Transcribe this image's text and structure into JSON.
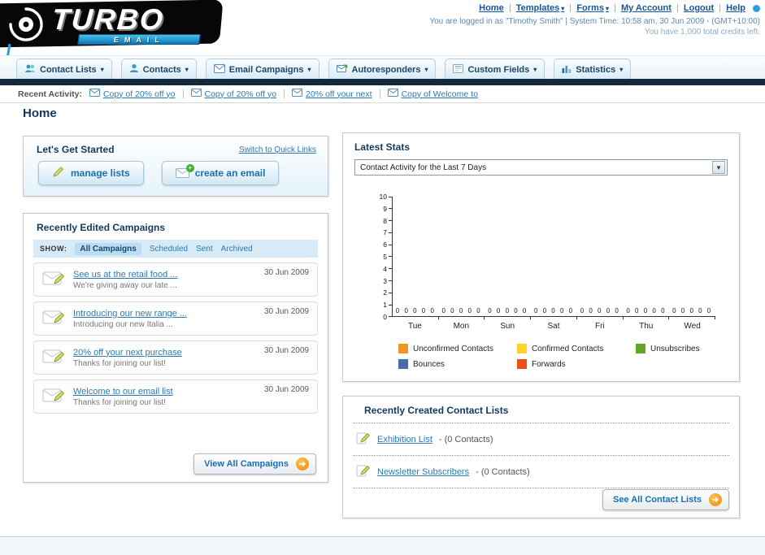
{
  "icons": {
    "caret_down": "▾",
    "select_arrow": "▼",
    "arrow_right": "➔"
  },
  "logo": {
    "title": "TURBO",
    "subtitle": "EMAIL"
  },
  "header": {
    "links": [
      {
        "label": "Home"
      },
      {
        "label": "Templates"
      },
      {
        "label": "Forms"
      },
      {
        "label": "My Account"
      },
      {
        "label": "Logout"
      },
      {
        "label": "Help"
      }
    ],
    "login_info": "You are logged in as \"Timothy Smith\" | System Time: 10:58 am, 30 Jun 2009 - (GMT+10:00)",
    "credits_info": "You have 1,000 total credits left."
  },
  "nav": {
    "tabs": [
      {
        "label": "Contact Lists"
      },
      {
        "label": "Contacts"
      },
      {
        "label": "Email Campaigns"
      },
      {
        "label": "Autoresponders"
      },
      {
        "label": "Custom Fields"
      },
      {
        "label": "Statistics"
      }
    ]
  },
  "activity": {
    "label": "Recent Activity:",
    "items": [
      {
        "label": "Copy of 20% off yo"
      },
      {
        "label": "Copy of 20% off yo"
      },
      {
        "label": "20% off your next"
      },
      {
        "label": "Copy of Welcome to"
      }
    ]
  },
  "page": {
    "title": "Home"
  },
  "get_started": {
    "title": "Let's Get Started",
    "switch_link": "Switch to Quick Links",
    "manage_lists_button": "manage lists",
    "create_email_button": "create an email"
  },
  "campaigns": {
    "title": "Recently Edited Campaigns",
    "show_label": "SHOW:",
    "filters": [
      {
        "label": "All Campaigns",
        "selected": true
      },
      {
        "label": "Scheduled",
        "selected": false
      },
      {
        "label": "Sent",
        "selected": false
      },
      {
        "label": "Archived",
        "selected": false
      }
    ],
    "items": [
      {
        "title": "See us at the retail food ...",
        "subtitle": "We're giving away our late ...",
        "date": "30 Jun 2009"
      },
      {
        "title": "Introducing our new range ...",
        "subtitle": "Introducing our new Italia ...",
        "date": "30 Jun 2009"
      },
      {
        "title": "20% off your next purchase",
        "subtitle": "Thanks for joining our list!",
        "date": "30 Jun 2009"
      },
      {
        "title": "Welcome to our email list",
        "subtitle": "Thanks for joining our list!",
        "date": "30 Jun 2009"
      }
    ],
    "view_all_button": "View All Campaigns"
  },
  "stats": {
    "title": "Latest Stats",
    "dropdown_value": "Contact Activity for the Last 7 Days"
  },
  "chart_data": {
    "type": "bar",
    "title": "Contact Activity for the Last 7 Days",
    "categories": [
      "Tue",
      "Mon",
      "Sun",
      "Sat",
      "Fri",
      "Thu",
      "Wed"
    ],
    "series": [
      {
        "name": "Unconfirmed Contacts",
        "color": "#f7941d",
        "values": [
          0,
          0,
          0,
          0,
          0,
          0,
          0
        ]
      },
      {
        "name": "Confirmed Contacts",
        "color": "#fed42b",
        "values": [
          0,
          0,
          0,
          0,
          0,
          0,
          0
        ]
      },
      {
        "name": "Unsubscribes",
        "color": "#61a624",
        "values": [
          0,
          0,
          0,
          0,
          0,
          0,
          0
        ]
      },
      {
        "name": "Bounces",
        "color": "#4a6ea0",
        "values": [
          0,
          0,
          0,
          0,
          0,
          0,
          0
        ]
      },
      {
        "name": "Forwards",
        "color": "#e8501d",
        "values": [
          0,
          0,
          0,
          0,
          0,
          0,
          0
        ]
      }
    ],
    "ylim": [
      0,
      10
    ],
    "ytick_step": 1,
    "grid": false,
    "legend_position": "bottom"
  },
  "contact_lists": {
    "title": "Recently Created Contact Lists",
    "items": [
      {
        "name": "Exhibition List",
        "meta": "- (0 Contacts)"
      },
      {
        "name": "Newsletter Subscribers",
        "meta": "- (0 Contacts)"
      }
    ],
    "see_all_button": "See All Contact Lists"
  }
}
